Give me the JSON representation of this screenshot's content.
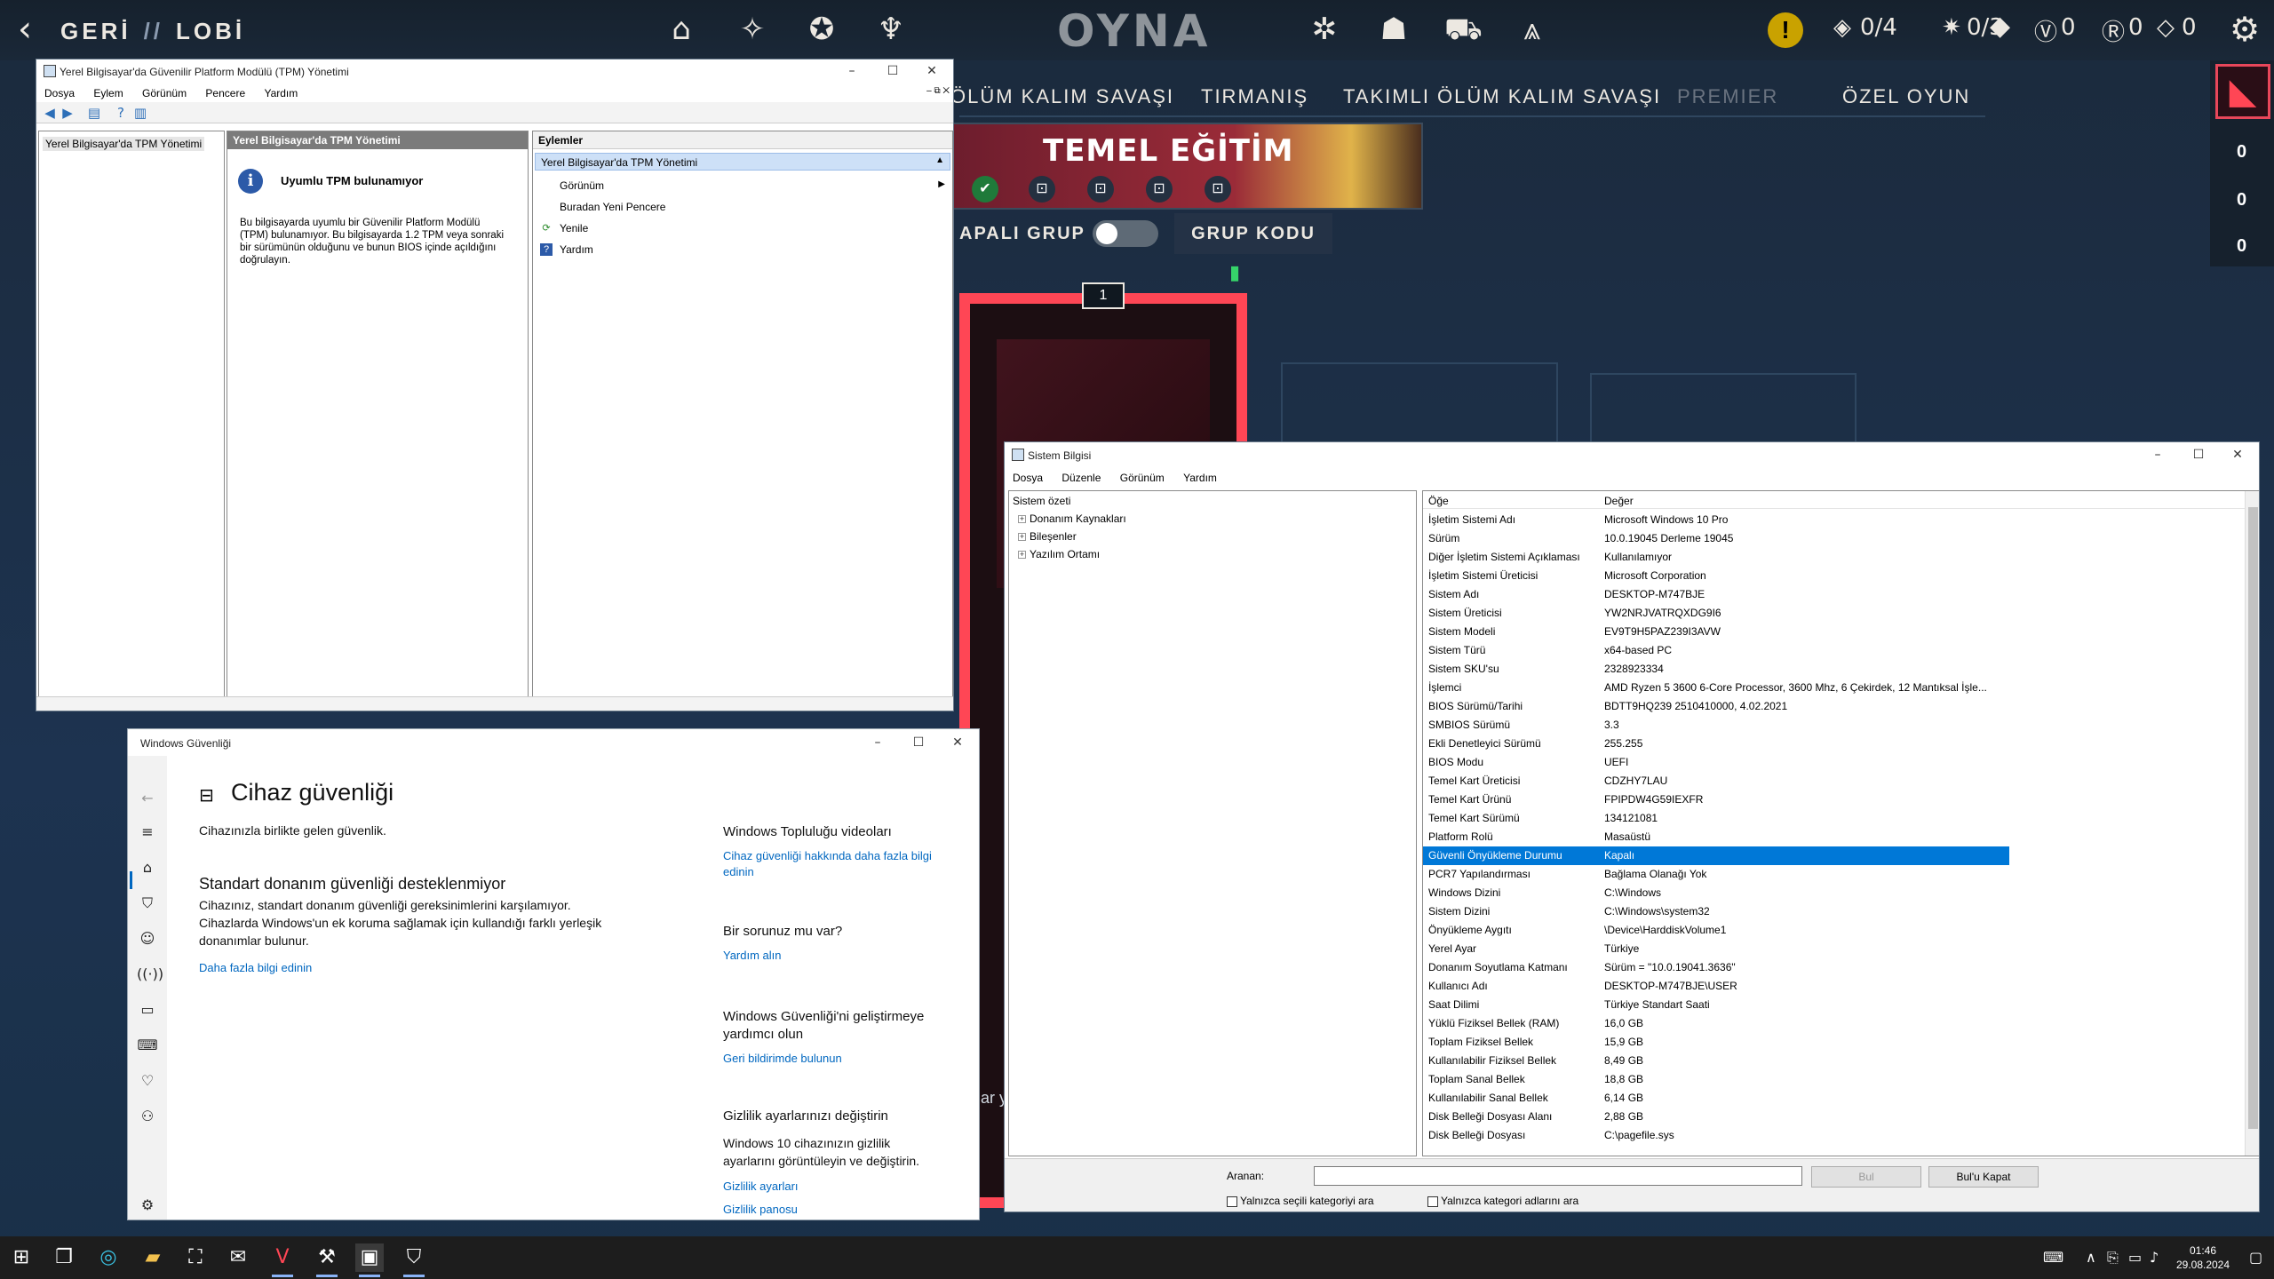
{
  "valorant": {
    "back_label": "GERİ",
    "separator": "//",
    "section": "LOBİ",
    "play": "OYNA",
    "currency": [
      {
        "icon": "kingdom-credit-icon",
        "value": "0/4"
      },
      {
        "icon": "radianite-star-icon",
        "value": "0/3"
      },
      {
        "icon": "valorant-points-icon",
        "value": "0"
      },
      {
        "icon": "radianite-points-icon",
        "value": "0"
      },
      {
        "icon": "kingdom-icon",
        "value": "0"
      }
    ],
    "modes": [
      "ÖLÜM KALIM SAVAŞI",
      "TIRMANIŞ",
      "TAKIMLI ÖLÜM KALIM SAVAŞI",
      "PREMIER",
      "ÖZEL OYUN"
    ],
    "training_title": "TEMEL EĞİTİM",
    "party_label": "APALI GRUP",
    "group_code": "GRUP KODU",
    "card_number": "1",
    "side_counts": [
      "0",
      "0",
      "0"
    ],
    "partial_text": "ar y"
  },
  "tpm_window": {
    "title": "Yerel Bilgisayar'da Güvenilir Platform Modülü (TPM) Yönetimi",
    "menu": [
      "Dosya",
      "Eylem",
      "Görünüm",
      "Pencere",
      "Yardım"
    ],
    "tree_item": "Yerel Bilgisayar'da TPM Yönetimi",
    "middle_header": "Yerel Bilgisayar'da TPM Yönetimi",
    "info_title": "Uyumlu TPM bulunamıyor",
    "info_body": "Bu bilgisayarda uyumlu bir Güvenilir Platform Modülü (TPM) bulunamıyor. Bu bilgisayarda 1.2 TPM veya sonraki bir sürümünün olduğunu ve bunun BIOS içinde açıldığını doğrulayın.",
    "actions_header": "Eylemler",
    "actions_sub": "Yerel Bilgisayar'da TPM Yönetimi",
    "actions": [
      "Görünüm",
      "Buradan Yeni Pencere",
      "Yenile",
      "Yardım"
    ]
  },
  "security_window": {
    "title": "Windows Güvenliği",
    "heading": "Cihaz güvenliği",
    "subtitle": "Cihazınızla birlikte gelen güvenlik.",
    "section_title": "Standart donanım güvenliği desteklenmiyor",
    "section_body": "Cihazınız, standart donanım güvenliği gereksinimlerini karşılamıyor. Cihazlarda Windows'un ek koruma sağlamak için kullandığı farklı yerleşik donanımlar bulunur.",
    "learn_more": "Daha fazla bilgi edinin",
    "right": {
      "videos_title": "Windows Topluluğu videoları",
      "videos_link": "Cihaz güvenliği hakkında daha fazla bilgi edinin",
      "question_title": "Bir sorunuz mu var?",
      "help_link": "Yardım alın",
      "improve_title": "Windows Güvenliği'ni geliştirmeye yardımcı olun",
      "feedback_link": "Geri bildirimde bulunun",
      "privacy_title": "Gizlilik ayarlarınızı değiştirin",
      "privacy_body": "Windows 10 cihazınızın gizlilik ayarlarını görüntüleyin ve değiştirin.",
      "privacy_link1": "Gizlilik ayarları",
      "privacy_link2": "Gizlilik panosu"
    }
  },
  "sysinfo_window": {
    "title": "Sistem Bilgisi",
    "menu": [
      "Dosya",
      "Düzenle",
      "Görünüm",
      "Yardım"
    ],
    "tree": [
      "Sistem özeti",
      "Donanım Kaynakları",
      "Bileşenler",
      "Yazılım Ortamı"
    ],
    "col_item": "Öğe",
    "col_value": "Değer",
    "rows": [
      [
        "İşletim Sistemi Adı",
        "Microsoft Windows 10 Pro"
      ],
      [
        "Sürüm",
        "10.0.19045 Derleme 19045"
      ],
      [
        "Diğer İşletim Sistemi Açıklaması",
        "Kullanılamıyor"
      ],
      [
        "İşletim Sistemi Üreticisi",
        "Microsoft Corporation"
      ],
      [
        "Sistem Adı",
        "DESKTOP-M747BJE"
      ],
      [
        "Sistem Üreticisi",
        "YW2NRJVATRQXDG9I6"
      ],
      [
        "Sistem Modeli",
        "EV9T9H5PAZ239I3AVW"
      ],
      [
        "Sistem Türü",
        "x64-based PC"
      ],
      [
        "Sistem SKU'su",
        "2328923334"
      ],
      [
        "İşlemci",
        "AMD Ryzen 5 3600 6-Core Processor, 3600 Mhz, 6 Çekirdek, 12 Mantıksal İşle..."
      ],
      [
        "BIOS Sürümü/Tarihi",
        "BDTT9HQ239 2510410000, 4.02.2021"
      ],
      [
        "SMBIOS Sürümü",
        "3.3"
      ],
      [
        "Ekli Denetleyici Sürümü",
        "255.255"
      ],
      [
        "BIOS Modu",
        "UEFI"
      ],
      [
        "Temel Kart Üreticisi",
        "CDZHY7LAU"
      ],
      [
        "Temel Kart Ürünü",
        "FPIPDW4G59IEXFR"
      ],
      [
        "Temel Kart Sürümü",
        "134121081"
      ],
      [
        "Platform Rolü",
        "Masaüstü"
      ],
      [
        "Güvenli Önyükleme Durumu",
        "Kapalı"
      ],
      [
        "PCR7 Yapılandırması",
        "Bağlama Olanağı Yok"
      ],
      [
        "Windows Dizini",
        "C:\\Windows"
      ],
      [
        "Sistem Dizini",
        "C:\\Windows\\system32"
      ],
      [
        "Önyükleme Aygıtı",
        "\\Device\\HarddiskVolume1"
      ],
      [
        "Yerel Ayar",
        "Türkiye"
      ],
      [
        "Donanım Soyutlama Katmanı",
        "Sürüm = \"10.0.19041.3636\""
      ],
      [
        "Kullanıcı Adı",
        "DESKTOP-M747BJE\\USER"
      ],
      [
        "Saat Dilimi",
        "Türkiye Standart Saati"
      ],
      [
        "Yüklü Fiziksel Bellek (RAM)",
        "16,0 GB"
      ],
      [
        "Toplam Fiziksel Bellek",
        "15,9 GB"
      ],
      [
        "Kullanılabilir Fiziksel Bellek",
        "8,49 GB"
      ],
      [
        "Toplam Sanal Bellek",
        "18,8 GB"
      ],
      [
        "Kullanılabilir Sanal Bellek",
        "6,14 GB"
      ],
      [
        "Disk Belleği Dosyası Alanı",
        "2,88 GB"
      ],
      [
        "Disk Belleği Dosyası",
        "C:\\pagefile.sys"
      ]
    ],
    "selected_row": "Güvenli Önyükleme Durumu",
    "find_label": "Aranan:",
    "find_value": "",
    "find_button": "Bul",
    "close_find_button": "Bul'u Kapat",
    "check1": "Yalnızca seçili kategoriyi ara",
    "check2": "Yalnızca kategori adlarını ara"
  },
  "taskbar": {
    "time": "01:46",
    "date": "29.08.2024"
  },
  "colors": {
    "valorant_red": "#ff4655",
    "selection_blue": "#0078d7",
    "link_blue": "#0067c0"
  }
}
